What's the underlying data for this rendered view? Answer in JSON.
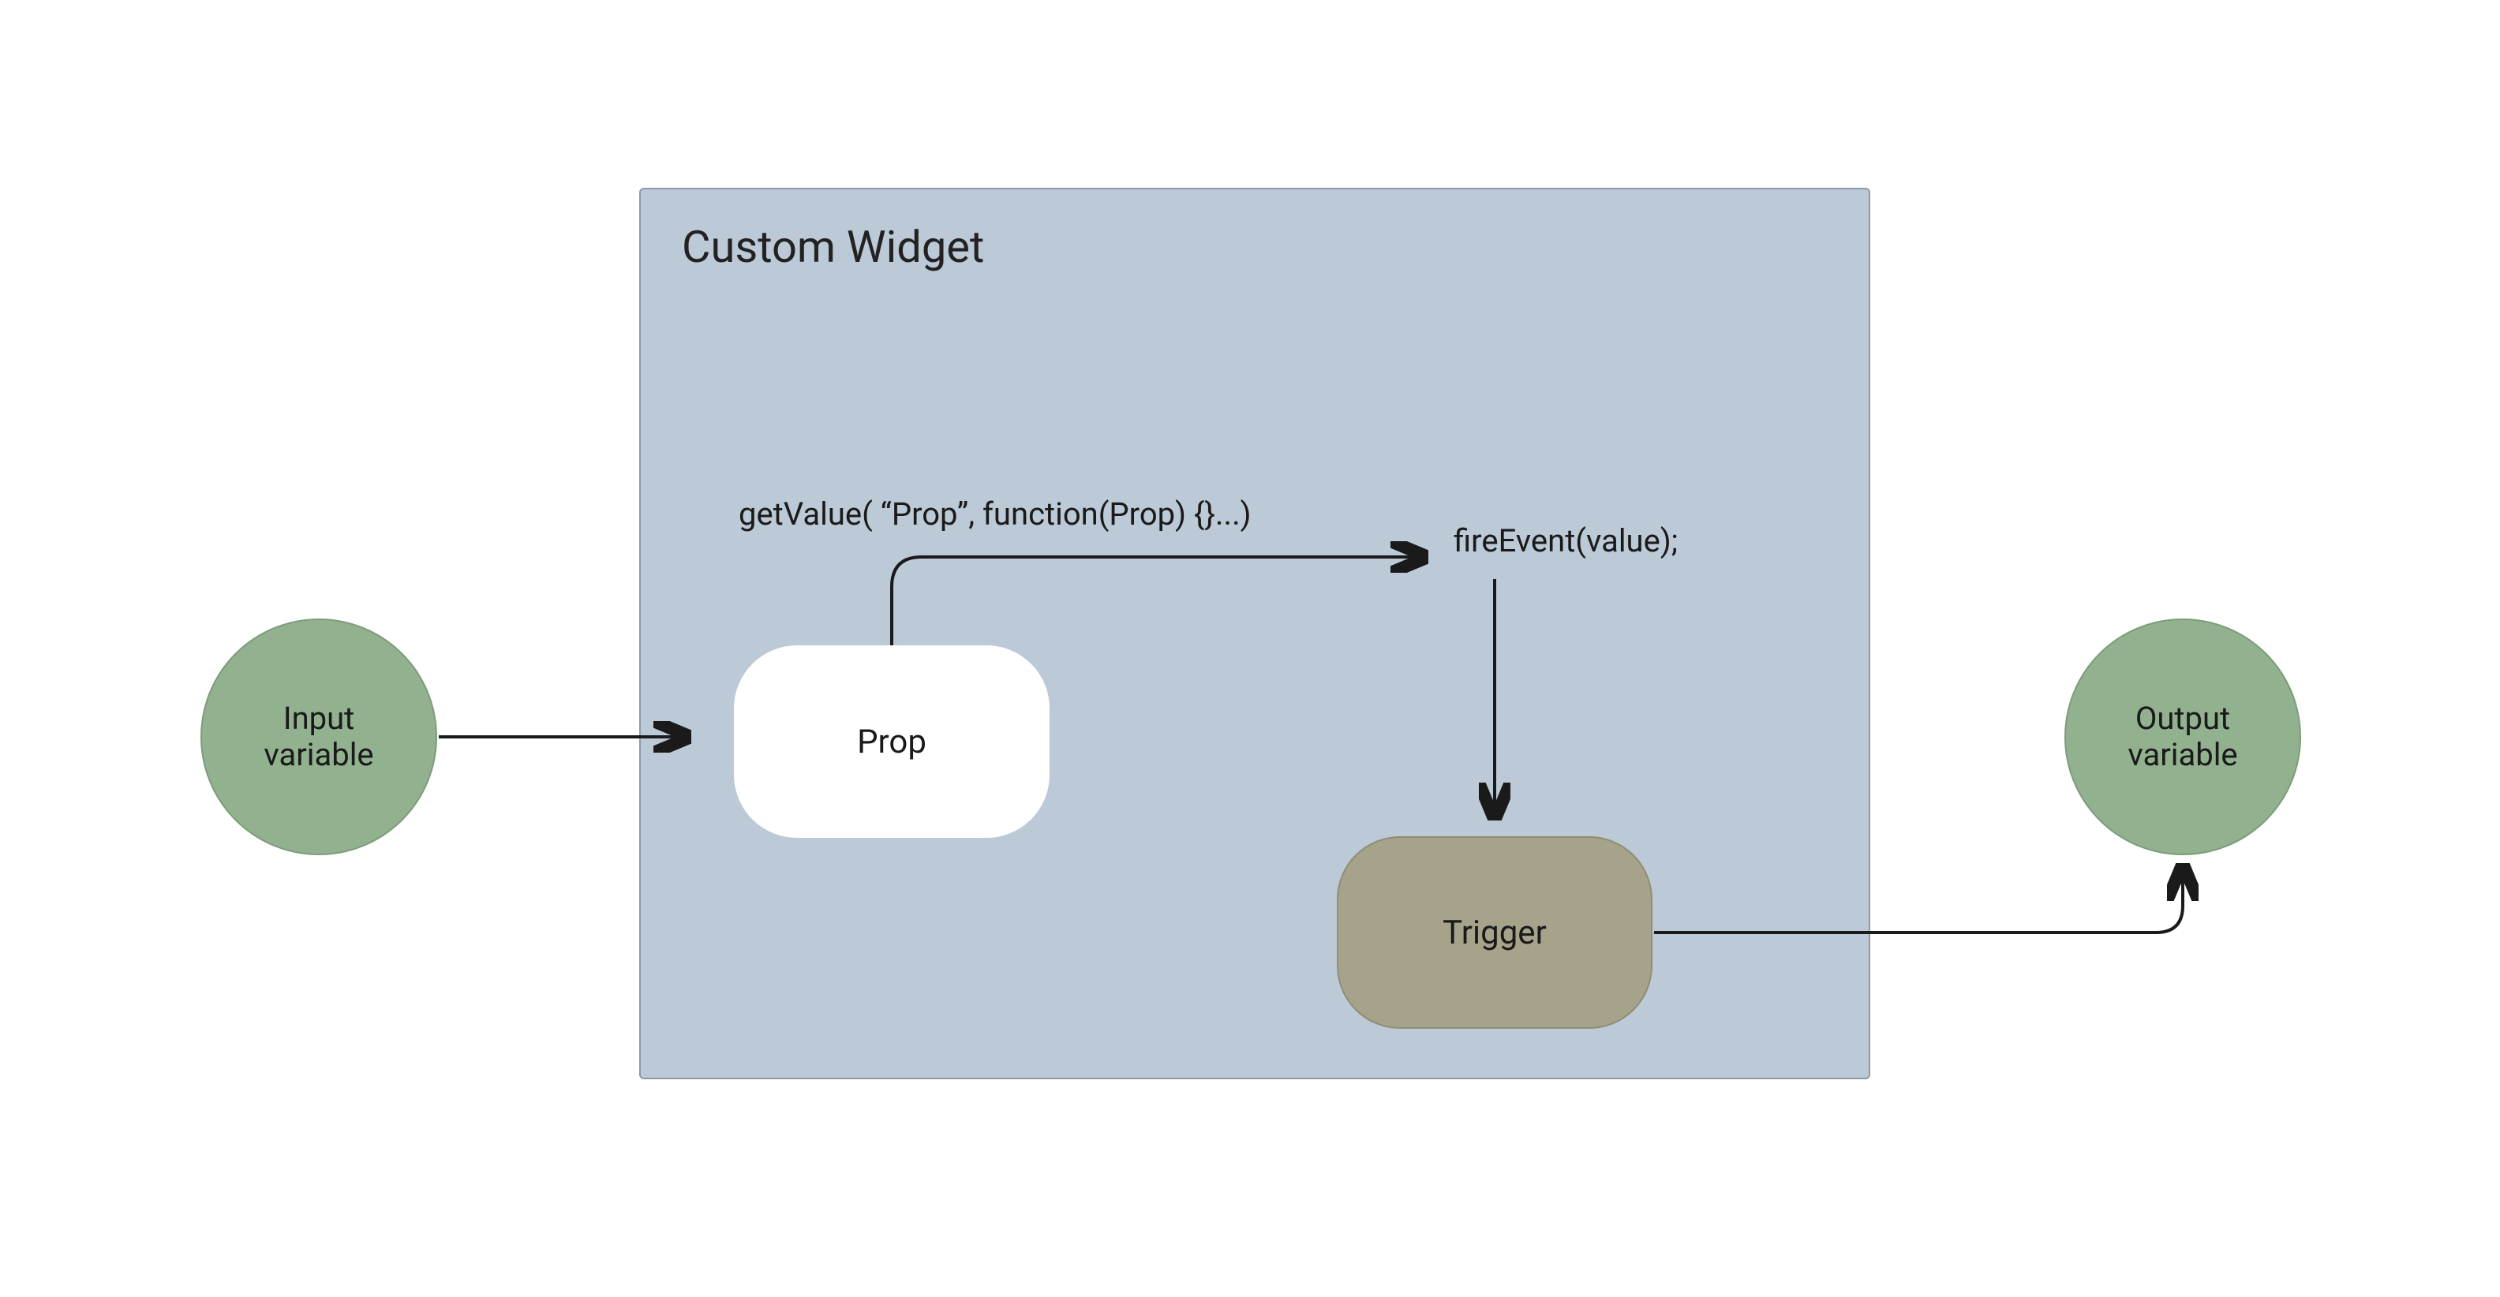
{
  "diagram": {
    "widget_title": "Custom Widget",
    "input_circle": "Input\nvariable",
    "output_circle": "Output\nvariable",
    "prop_node": "Prop",
    "trigger_node": "Trigger",
    "get_value_label": "getValue( “Prop”, function(Prop) {}...)",
    "fire_event_label": "fireEvent(value);"
  }
}
